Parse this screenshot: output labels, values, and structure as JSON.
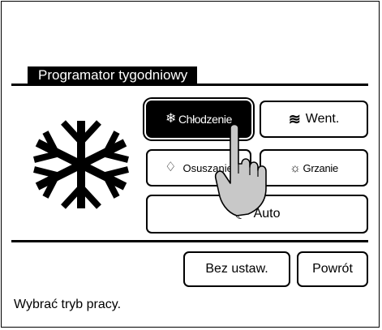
{
  "screen": {
    "title": "Programator tygodniowy",
    "current_mode_icon": "snowflake-icon"
  },
  "modes": {
    "cooling": {
      "icon": "❄",
      "label": "Chłodzenie",
      "selected": true
    },
    "fan": {
      "icon": "≋",
      "label": "Went.",
      "selected": false
    },
    "dry": {
      "icon": "♢",
      "label": "Osuszanie",
      "selected": false
    },
    "heating": {
      "icon": "☼",
      "label": "Grzanie",
      "selected": false
    },
    "auto": {
      "icon": "☾",
      "label": "Auto",
      "selected": false
    }
  },
  "footer": {
    "no_setting_label": "Bez ustaw.",
    "back_label": "Powrót"
  },
  "status": {
    "text": "Wybrać tryb pracy."
  },
  "colors": {
    "foreground": "#000000",
    "background": "#ffffff",
    "selected_fill": "#000000",
    "selected_text": "#ffffff",
    "hand_fill": "#c8c8c8"
  }
}
